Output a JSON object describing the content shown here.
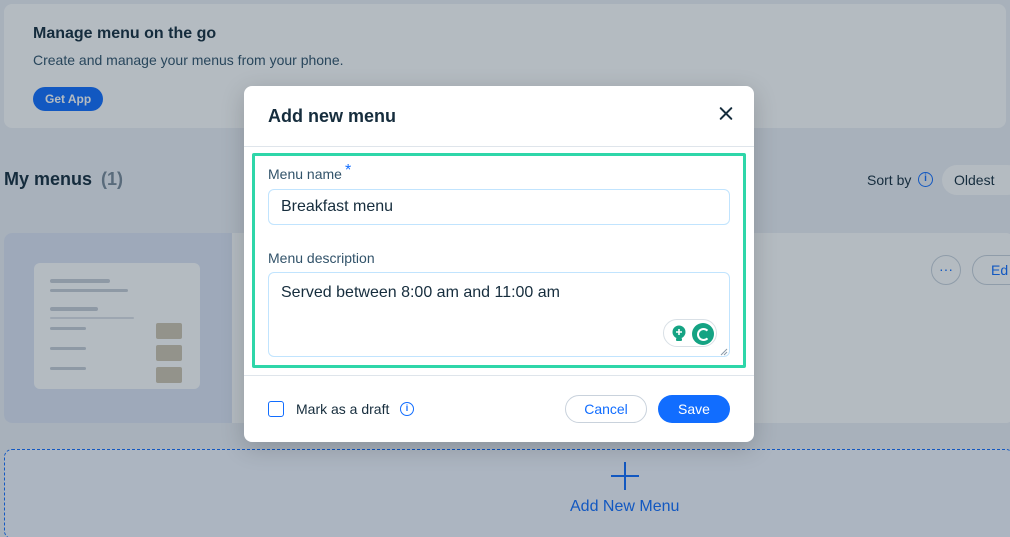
{
  "promo": {
    "title": "Manage menu on the go",
    "subtitle": "Create and manage your menus from your phone.",
    "button_label": "Get App"
  },
  "menus_section": {
    "title": "My menus",
    "count": "(1)",
    "sort_label": "Sort by",
    "sort_value": "Oldest",
    "more_label": "···",
    "edit_label": "Ed",
    "add_label": "Add New Menu"
  },
  "modal": {
    "title": "Add new menu",
    "name_label": "Menu name",
    "required_marker": "*",
    "name_value": "Breakfast menu",
    "description_label": "Menu description",
    "description_value": "Served between 8:00 am and 11:00 am",
    "draft_label": "Mark as a draft",
    "draft_checked": false,
    "cancel_label": "Cancel",
    "save_label": "Save"
  },
  "colors": {
    "accent": "#116dff",
    "highlight": "#2ed6a9",
    "grammarly": "#15a383"
  },
  "icons": [
    "close-icon",
    "info-icon",
    "plus-icon",
    "more-icon",
    "lightbulb-icon",
    "grammarly-icon",
    "resize-handle-icon"
  ]
}
